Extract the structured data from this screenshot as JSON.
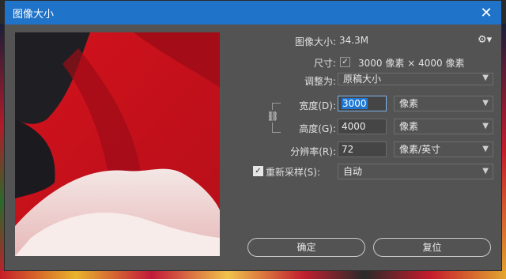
{
  "window": {
    "title": "图像大小"
  },
  "image_size": {
    "label": "图像大小:",
    "value": "34.3M"
  },
  "dimensions": {
    "label": "尺寸:",
    "width": "3000",
    "unit1": "像素",
    "times": "×",
    "height": "4000",
    "unit2": "像素"
  },
  "fit_to": {
    "label": "调整为:",
    "value": "原稿大小"
  },
  "width": {
    "label": "宽度(D):",
    "value": "3000",
    "unit": "像素"
  },
  "height": {
    "label": "高度(G):",
    "value": "4000",
    "unit": "像素"
  },
  "resolution": {
    "label": "分辨率(R):",
    "value": "72",
    "unit": "像素/英寸"
  },
  "resample": {
    "label": "重新采样(S):",
    "checked": true,
    "value": "自动"
  },
  "buttons": {
    "ok": "确定",
    "reset": "复位"
  },
  "icons": {
    "gear": "gear-icon",
    "close": "close-icon",
    "link": "chain-link-icon",
    "chevron": "chevron-down-icon"
  },
  "colors": {
    "titlebar": "#1f73c9",
    "dialog_bg": "#535353",
    "selection": "#1e78d4"
  }
}
